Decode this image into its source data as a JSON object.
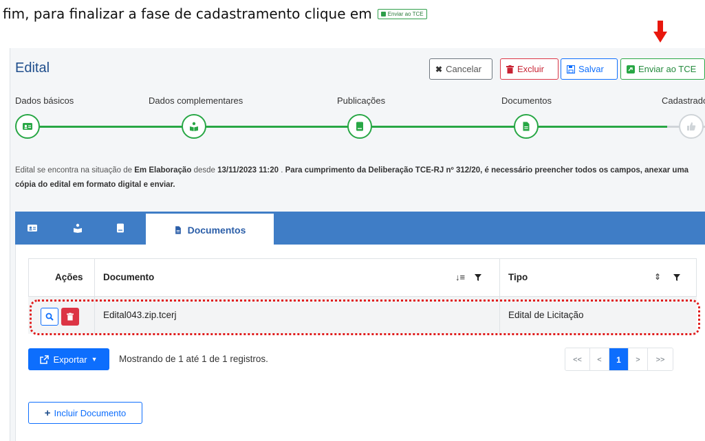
{
  "doc": {
    "instruction": "fim, para finalizar a fase de cadastramento clique em",
    "mini_button": "Enviar ao TCE"
  },
  "header": {
    "title": "Edital",
    "cancel_label": "Cancelar",
    "delete_label": "Excluir",
    "save_label": "Salvar",
    "send_label": "Enviar ao TCE"
  },
  "stepper": {
    "steps": [
      {
        "label": "Dados básicos",
        "icon": "id-card-icon",
        "done": true
      },
      {
        "label": "Dados complementares",
        "icon": "person-book-icon",
        "done": true
      },
      {
        "label": "Publicações",
        "icon": "book-icon",
        "done": true
      },
      {
        "label": "Documentos",
        "icon": "file-icon",
        "done": true
      },
      {
        "label": "Cadastrado",
        "icon": "thumbs-up-icon",
        "done": false
      }
    ]
  },
  "info": {
    "p1": "Edital se encontra na situação de",
    "status": "Em Elaboração",
    "p2": "desde",
    "date": "13/11/2023 11:20",
    "p3": ".",
    "bold": "Para cumprimento da Deliberação TCE-RJ nº 312/20, é necessário preencher todos os campos, anexar uma cópia do edital em formato digital e enviar."
  },
  "tabs": {
    "active_label": "Documentos",
    "icons": [
      "id-card-icon",
      "person-book-icon",
      "book-icon",
      "file-icon"
    ]
  },
  "table": {
    "headers": {
      "actions": "Ações",
      "document": "Documento",
      "type": "Tipo"
    },
    "rows": [
      {
        "document": "Edital043.zip.tcerj",
        "type": "Edital de Licitação"
      }
    ]
  },
  "footer": {
    "export_label": "Exportar",
    "showing": "Mostrando de 1 até 1 de 1 registros.",
    "pager": [
      "<<",
      "<",
      "1",
      ">",
      ">>"
    ],
    "current_page": "1",
    "include_label": "Incluir Documento"
  },
  "colors": {
    "green": "#28a745",
    "blue": "#0d6efd",
    "tab_blue": "#3f7dc6",
    "red": "#dc3545",
    "title_blue": "#1f4e8c"
  }
}
